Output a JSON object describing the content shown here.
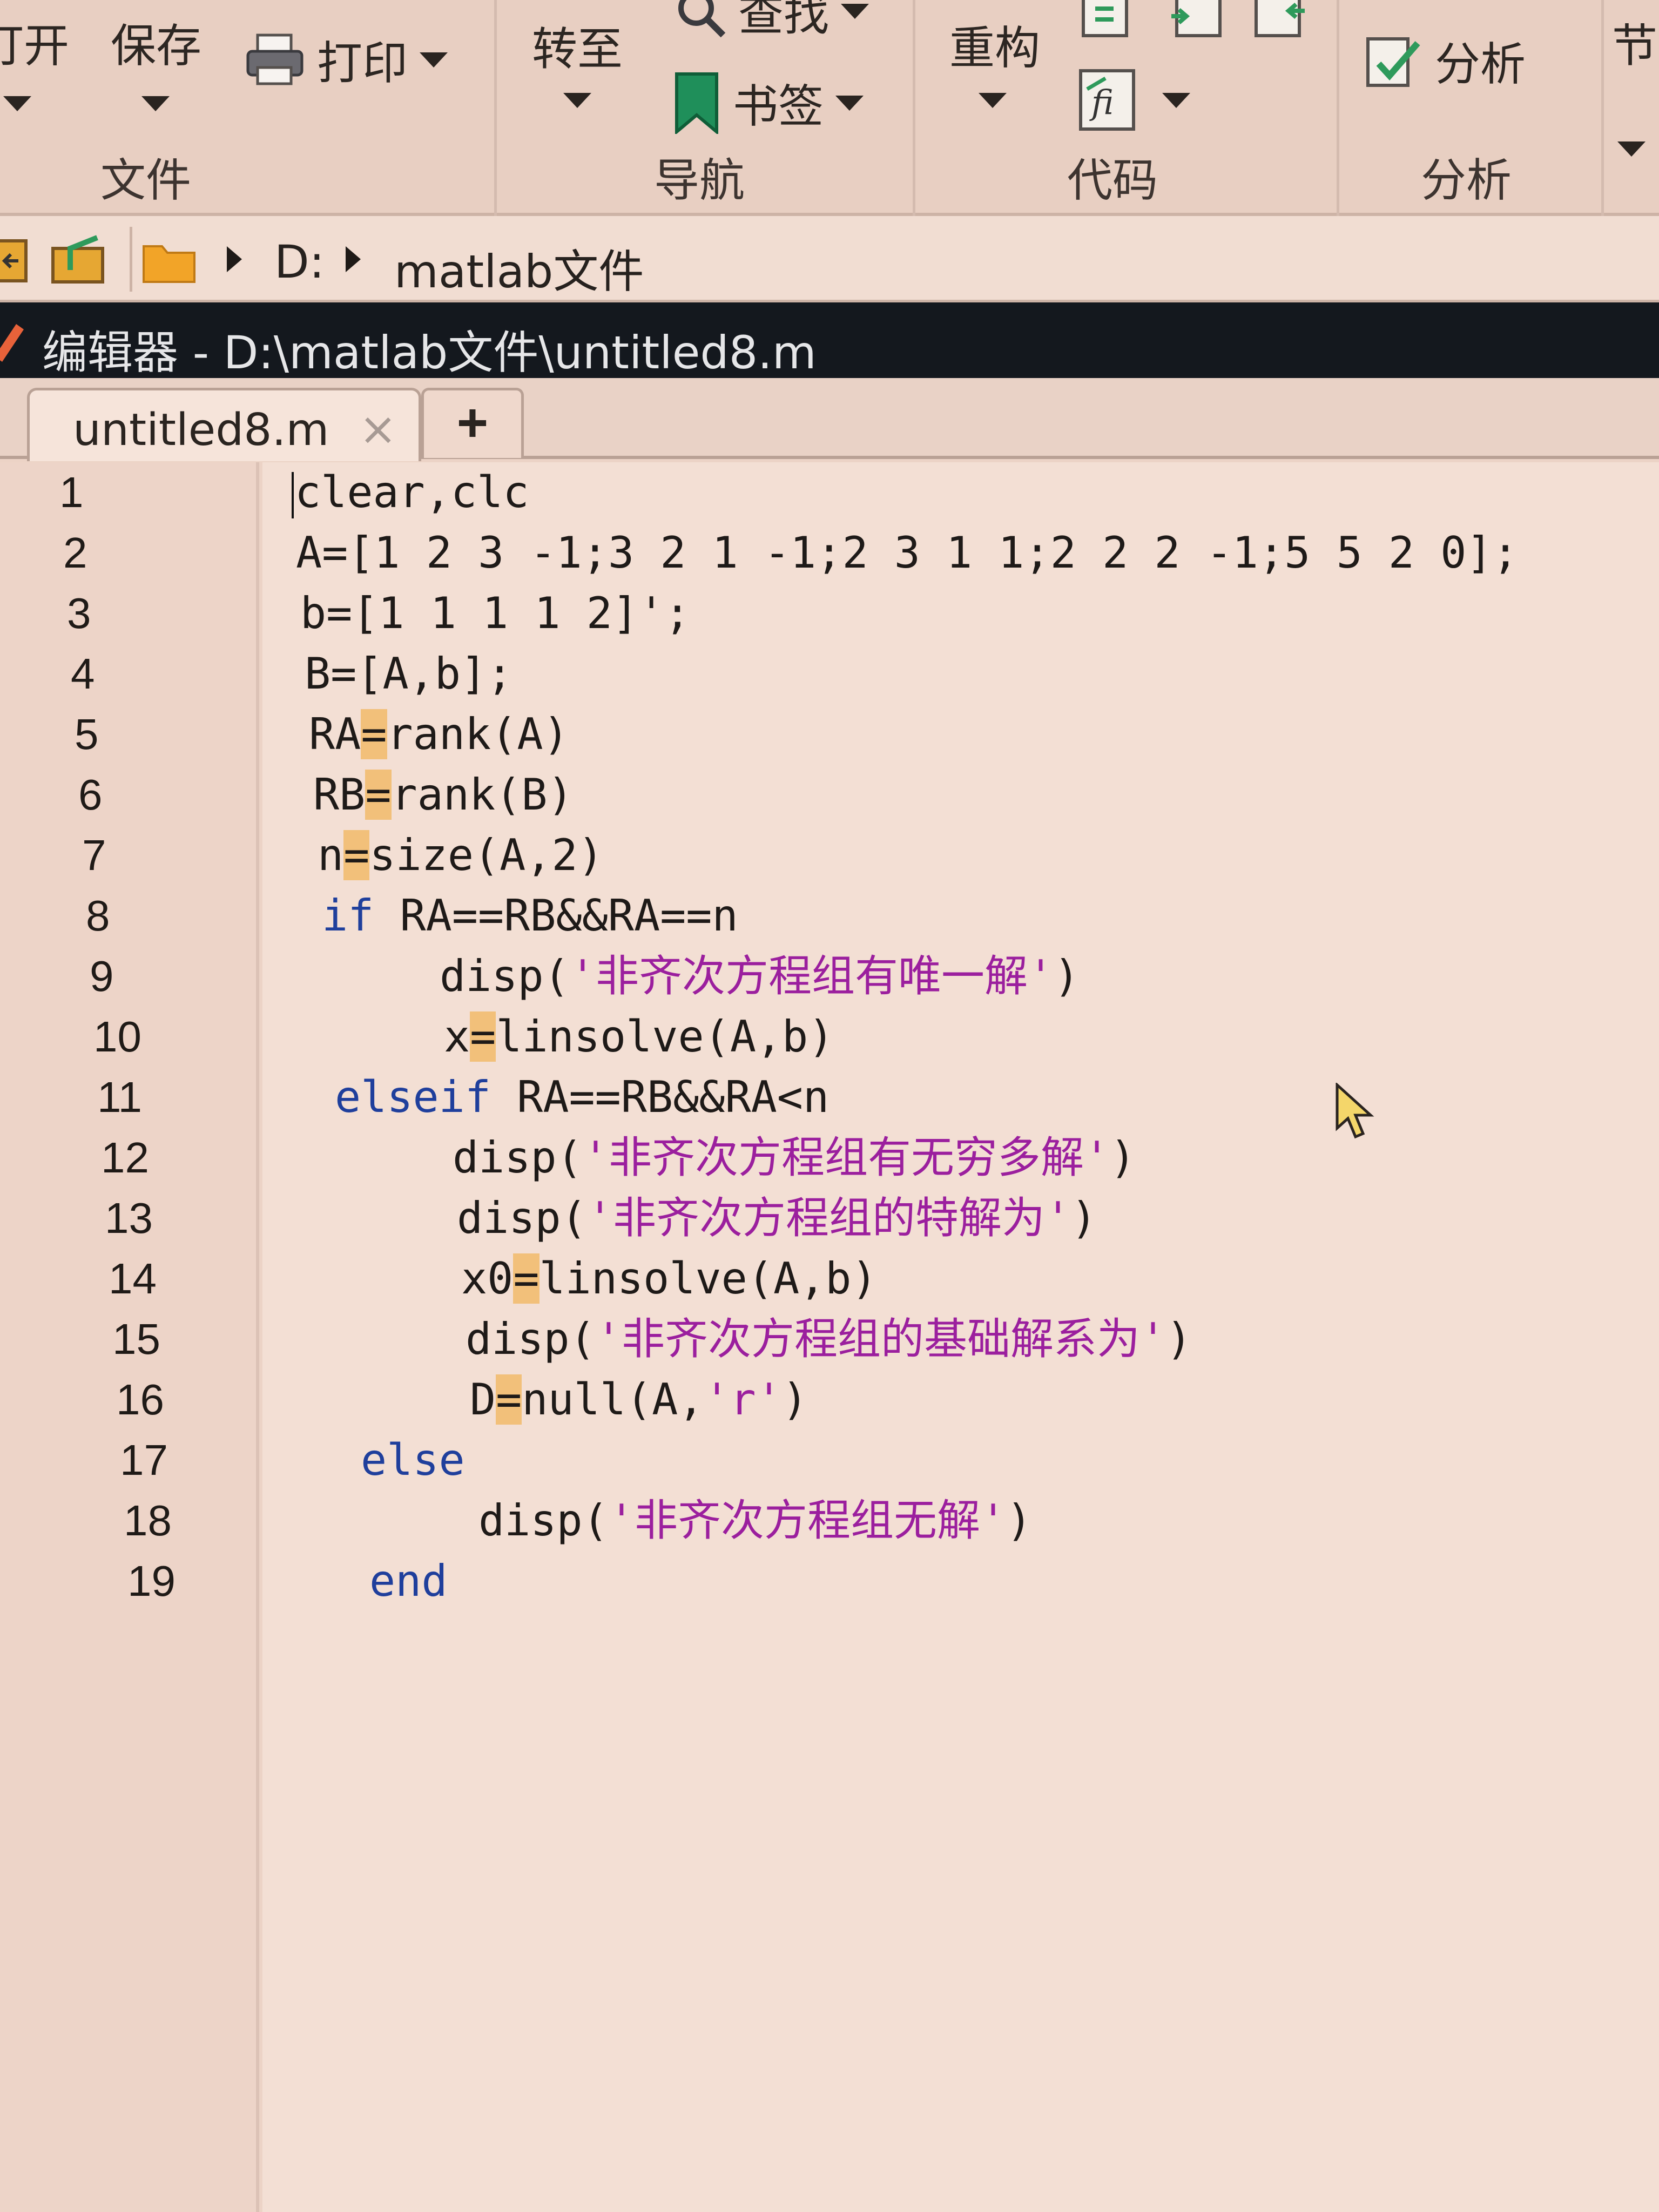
{
  "ribbon": {
    "file_group": {
      "open_label": "打开",
      "save_label": "保存",
      "print_label": "打印",
      "group_label": "文件"
    },
    "nav_group": {
      "goto_label": "转至",
      "find_label": "查找",
      "bookmark_label": "书签",
      "group_label": "导航"
    },
    "code_group": {
      "refactor_label": "重构",
      "group_label": "代码"
    },
    "analyze_group": {
      "analyze_label": "分析",
      "group_label": "分析"
    },
    "section_label": "节"
  },
  "address": {
    "drive": "D:",
    "folder": "matlab文件"
  },
  "editor": {
    "title": "编辑器 - D:\\matlab文件\\untitled8.m",
    "tab_name": "untitled8.m",
    "tab_close": "×",
    "new_tab": "+"
  },
  "code_lines": [
    {
      "num": "1",
      "pre": "",
      "a": "clear,clc"
    },
    {
      "num": "2",
      "pre": "",
      "a": "A=[1 2 3 -1;3 2 1 -1;2 3 1 1;2 2 2 -1;5 5 2 0];"
    },
    {
      "num": "3",
      "pre": "",
      "a": "b=[1 1 1 1 2]';"
    },
    {
      "num": "4",
      "pre": "",
      "a": "B=[A,b];"
    },
    {
      "num": "5",
      "pre": "RA",
      "eq": "=",
      "a": "rank(A)"
    },
    {
      "num": "6",
      "pre": "RB",
      "eq": "=",
      "a": "rank(B)"
    },
    {
      "num": "7",
      "pre": "n",
      "eq": "=",
      "a": "size(A,2)"
    },
    {
      "num": "8",
      "kw": "if",
      "a": " RA==RB&&RA==n"
    },
    {
      "num": "9",
      "a": "disp(",
      "str": "'非齐次方程组有唯一解'",
      "b": ")"
    },
    {
      "num": "10",
      "pre": "x",
      "eq": "=",
      "a": "linsolve(A,b)"
    },
    {
      "num": "11",
      "kw": "elseif",
      "a": " RA==RB&&RA<n"
    },
    {
      "num": "12",
      "a": "disp(",
      "str": "'非齐次方程组有无穷多解'",
      "b": ")"
    },
    {
      "num": "13",
      "a": "disp(",
      "str": "'非齐次方程组的特解为'",
      "b": ")"
    },
    {
      "num": "14",
      "pre": "x0",
      "eq": "=",
      "a": "linsolve(A,b)"
    },
    {
      "num": "15",
      "a": "disp(",
      "str": "'非齐次方程组的基础解系为'",
      "b": ")"
    },
    {
      "num": "16",
      "pre": "D",
      "eq": "=",
      "a": "null(A,",
      "str": "'r'",
      "b": ")"
    },
    {
      "num": "17",
      "kw": "else"
    },
    {
      "num": "18",
      "a": "disp(",
      "str": "'非齐次方程组无解'",
      "b": ")"
    },
    {
      "num": "19",
      "kw": "end"
    }
  ],
  "colors": {
    "keyword": "#1f3f9c",
    "string": "#9b1f9e",
    "titlebar": "#14181e"
  }
}
